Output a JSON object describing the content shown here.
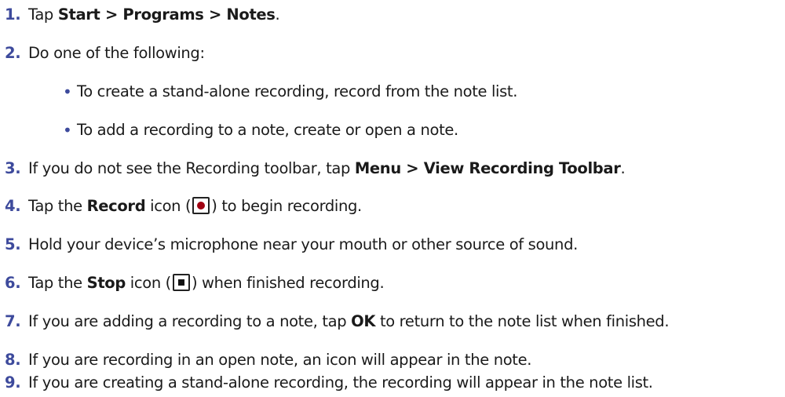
{
  "steps": [
    {
      "num": "1.",
      "pre": "Tap ",
      "bold": "Start > Programs > Notes",
      "post": "."
    },
    {
      "num": "2.",
      "text": "Do one of the following:"
    },
    {
      "bullet": "•",
      "text": "To create a stand-alone recording, record from the note list."
    },
    {
      "bullet": "•",
      "text": "To add a recording to a note, create or open a note."
    },
    {
      "num": "3.",
      "pre": "If you do not see the Recording toolbar, tap ",
      "bold": "Menu > View Recording Toolbar",
      "post": "."
    },
    {
      "num": "4.",
      "pre": "Tap the ",
      "bold": "Record",
      "mid": " icon (",
      "post": ") to begin recording.",
      "icon": "record-icon"
    },
    {
      "num": "5.",
      "text": "Hold your device’s microphone near your mouth or other source of sound."
    },
    {
      "num": "6.",
      "pre": "Tap the ",
      "bold": "Stop",
      "mid": " icon (",
      "post": ") when finished recording.",
      "icon": "stop-icon"
    },
    {
      "num": "7.",
      "pre": "If you are adding a recording to a note, tap ",
      "bold": "OK",
      "post": " to return to the note list when finished."
    },
    {
      "num": "8.",
      "text": "If you are recording in an open note, an icon will appear in the note."
    },
    {
      "num": "9.",
      "text": "If you are creating a stand-alone recording, the recording will appear in the note list."
    }
  ],
  "colors": {
    "number": "#3d4a9c",
    "record_dot": "#a00012"
  }
}
